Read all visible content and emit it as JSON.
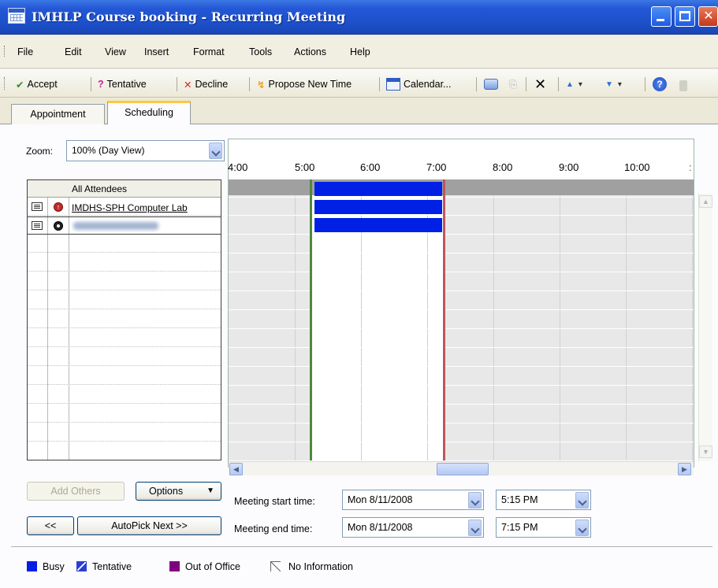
{
  "window": {
    "title": "IMHLP Course booking - Recurring Meeting",
    "controls": [
      "minimize",
      "maximize",
      "close"
    ]
  },
  "menu": [
    "File",
    "Edit",
    "View",
    "Insert",
    "Format",
    "Tools",
    "Actions",
    "Help"
  ],
  "toolbar": {
    "accept": "Accept",
    "tentative": "Tentative",
    "decline": "Decline",
    "propose": "Propose New Time",
    "calendar": "Calendar..."
  },
  "tabs": [
    "Appointment",
    "Scheduling"
  ],
  "active_tab": "Scheduling",
  "zoom": {
    "label": "Zoom:",
    "value": "100% (Day View)"
  },
  "attendees": {
    "header": "All Attendees",
    "rows": [
      {
        "name": "IMDHS-SPH Computer Lab",
        "type": "required"
      },
      {
        "name": "",
        "type": "optional",
        "obscured": true
      }
    ]
  },
  "timeline": {
    "hours": [
      "4:00",
      "5:00",
      "6:00",
      "7:00",
      "8:00",
      "9:00",
      "10:00"
    ],
    "meeting_start": "5:15 PM",
    "meeting_end": "7:15 PM",
    "busy_color": "#0020e6"
  },
  "buttons": {
    "add_others": "Add Others",
    "options": "Options",
    "prev": "<<",
    "autopick": "AutoPick Next >>"
  },
  "meeting": {
    "start_label": "Meeting start time:",
    "start_date": "Mon 8/11/2008",
    "start_time": "5:15 PM",
    "end_label": "Meeting end time:",
    "end_date": "Mon 8/11/2008",
    "end_time": "7:15 PM"
  },
  "legend": [
    {
      "label": "Busy",
      "color": "#0020e6"
    },
    {
      "label": "Tentative",
      "color": "#2a3fd6"
    },
    {
      "label": "Out of Office",
      "color": "#800080"
    },
    {
      "label": "No Information",
      "color": "#ffffff"
    }
  ]
}
